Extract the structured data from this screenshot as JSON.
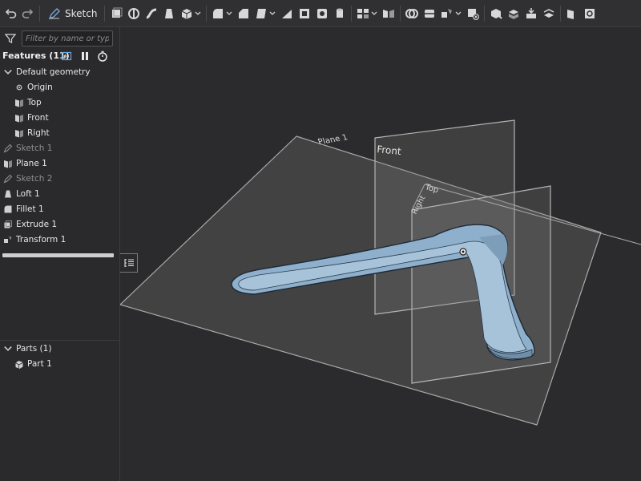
{
  "toolbar": {
    "sketch_label": "Sketch",
    "icons": [
      "undo-icon",
      "redo-icon",
      "sketch-pencil-icon",
      "extrude-icon",
      "revolve-icon",
      "sweep-icon",
      "loft-icon",
      "thicken-icon",
      "fillet-icon",
      "chamfer-icon",
      "draft-icon",
      "rib-icon",
      "shell-icon",
      "hole-icon",
      "cylinder-icon",
      "pattern-icon",
      "mirror-icon",
      "boolean-icon",
      "split-icon",
      "transform-icon",
      "delete-part-icon",
      "modify-fillet-icon",
      "move-face-icon",
      "replace-face-icon",
      "offset-surface-icon",
      "plane-icon"
    ]
  },
  "filter": {
    "placeholder": "Filter by name or type"
  },
  "features": {
    "title": "Features (11)",
    "default_geometry_label": "Default geometry",
    "items": [
      {
        "label": "Origin",
        "icon": "origin-icon",
        "dim": false
      },
      {
        "label": "Top",
        "icon": "plane-icon",
        "dim": false
      },
      {
        "label": "Front",
        "icon": "plane-icon",
        "dim": false
      },
      {
        "label": "Right",
        "icon": "plane-icon",
        "dim": false
      },
      {
        "label": "Sketch 1",
        "icon": "sketch-icon",
        "dim": true
      },
      {
        "label": "Plane 1",
        "icon": "plane-icon",
        "dim": false
      },
      {
        "label": "Sketch 2",
        "icon": "sketch-icon",
        "dim": true
      },
      {
        "label": "Loft 1",
        "icon": "loft-icon",
        "dim": false
      },
      {
        "label": "Fillet 1",
        "icon": "fillet-icon",
        "dim": false
      },
      {
        "label": "Extrude 1",
        "icon": "extrude-icon",
        "dim": false
      },
      {
        "label": "Transform 1",
        "icon": "transform-icon",
        "dim": false
      }
    ]
  },
  "parts": {
    "title": "Parts (1)",
    "items": [
      {
        "label": "Part 1",
        "icon": "part-icon"
      }
    ]
  },
  "viewport": {
    "plane_labels": {
      "plane1": "Plane 1",
      "front": "Front",
      "top": "Top",
      "right": "Right"
    },
    "part_color": "#8fb0cc"
  }
}
